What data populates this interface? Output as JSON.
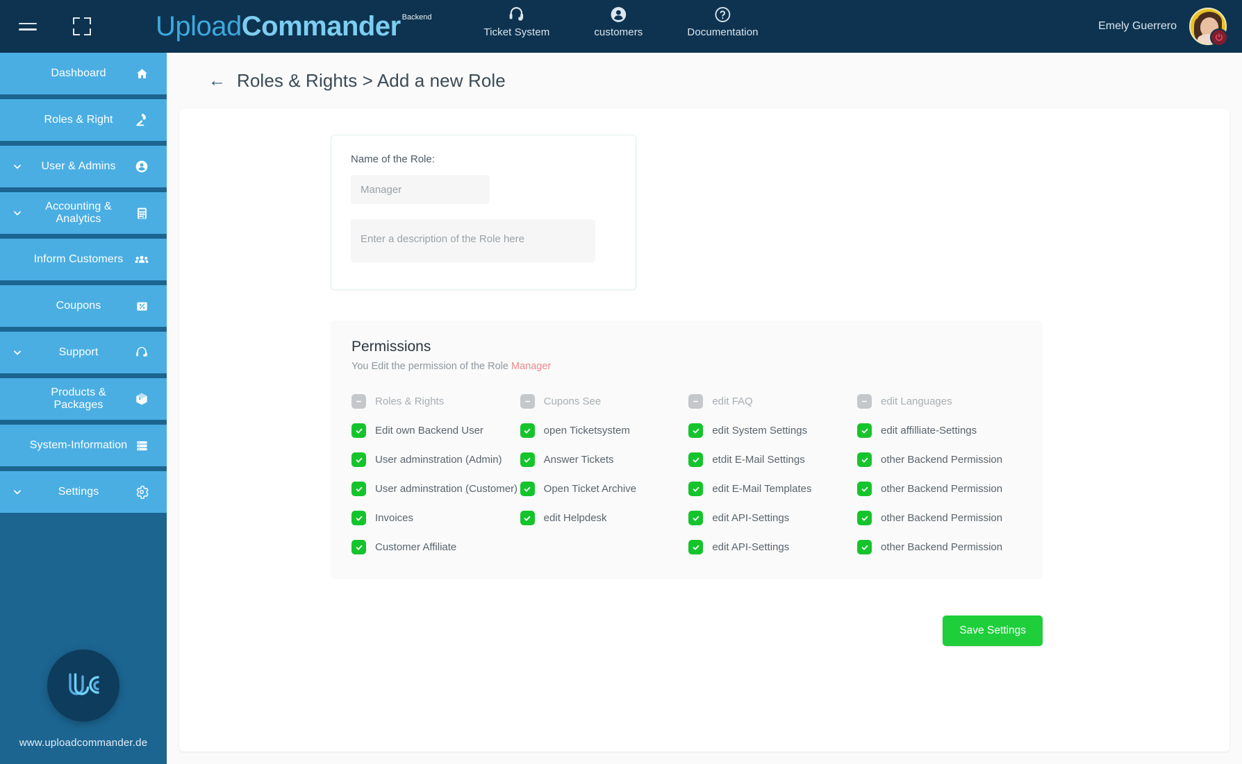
{
  "topbar": {
    "menu_icon": "hamburger-icon",
    "fullscreen_icon": "fullscreen-icon",
    "brand_part1": "Upload",
    "brand_part2": "Commander",
    "brand_superscript": "Backend",
    "nav": [
      {
        "label": "Ticket System",
        "icon": "headset-icon"
      },
      {
        "label": "customers",
        "icon": "person-circle-icon"
      },
      {
        "label": "Documentation",
        "icon": "question-circle-icon"
      }
    ],
    "user_name": "Emely Guerrero",
    "logout_icon": "power-icon"
  },
  "sidebar": {
    "items": [
      {
        "label": "Dashboard",
        "icon": "home-icon",
        "expandable": false
      },
      {
        "label": "Roles & Right",
        "icon": "gavel-icon",
        "expandable": false
      },
      {
        "label": "User & Admins",
        "icon": "person-circle-icon",
        "expandable": true
      },
      {
        "label": "Accounting & Analytics",
        "icon": "calculator-icon",
        "expandable": true
      },
      {
        "label": "Inform Customers",
        "icon": "people-icon",
        "expandable": false
      },
      {
        "label": "Coupons",
        "icon": "percent-tag-icon",
        "expandable": false
      },
      {
        "label": "Support",
        "icon": "headset-icon",
        "expandable": true
      },
      {
        "label": "Products & Packages",
        "icon": "box-icon",
        "expandable": false
      },
      {
        "label": "System-Information",
        "icon": "server-icon",
        "expandable": false
      },
      {
        "label": "Settings",
        "icon": "gear-icon",
        "expandable": true
      }
    ],
    "logo_alt": "uc-logo",
    "url": "www.uploadcommander.de"
  },
  "header": {
    "back_icon": "arrow-left-icon",
    "title": "Roles & Rights > Add a new Role"
  },
  "role_form": {
    "name_label": "Name of the Role:",
    "name_placeholder": "Manager",
    "name_value": "",
    "description_placeholder": "Enter a description of the Role here",
    "description_value": ""
  },
  "permissions": {
    "title": "Permissions",
    "subtitle_prefix": "You Edit the permission of the Role ",
    "subtitle_role": "Manager",
    "columns": [
      {
        "items": [
          {
            "label": "Roles & Rights",
            "checked": false
          },
          {
            "label": "Edit own Backend User",
            "checked": true
          },
          {
            "label": "User adminstration (Admin)",
            "checked": true
          },
          {
            "label": "User adminstration (Customer)",
            "checked": true
          },
          {
            "label": "Invoices",
            "checked": true
          },
          {
            "label": "Customer Affiliate",
            "checked": true
          }
        ]
      },
      {
        "items": [
          {
            "label": "Cupons See",
            "checked": false
          },
          {
            "label": "open Ticketsystem",
            "checked": true
          },
          {
            "label": "Answer Tickets",
            "checked": true
          },
          {
            "label": "Open Ticket Archive",
            "checked": true
          },
          {
            "label": "edit Helpdesk",
            "checked": true
          }
        ]
      },
      {
        "items": [
          {
            "label": "edit FAQ",
            "checked": false
          },
          {
            "label": "edit System Settings",
            "checked": true
          },
          {
            "label": "etdit E-Mail Settings",
            "checked": true
          },
          {
            "label": "edit E-Mail Templates",
            "checked": true
          },
          {
            "label": "edit API-Settings",
            "checked": true
          },
          {
            "label": "edit API-Settings",
            "checked": true
          }
        ]
      },
      {
        "items": [
          {
            "label": "edit Languages",
            "checked": false
          },
          {
            "label": "edit affilliate-Settings",
            "checked": true
          },
          {
            "label": "other Backend Permission",
            "checked": true
          },
          {
            "label": "other Backend Permission",
            "checked": true
          },
          {
            "label": "other Backend Permission",
            "checked": true
          },
          {
            "label": "other Backend Permission",
            "checked": true
          }
        ]
      }
    ]
  },
  "actions": {
    "save_label": "Save Settings"
  },
  "colors": {
    "topbar_bg": "#0d3350",
    "sidebar_bg": "#1c6591",
    "sidebar_item": "#4aaee3",
    "checkbox_on": "#15c42c",
    "checkbox_off": "#c5c8cb",
    "save_button": "#1ece3a",
    "role_highlight": "#e98b8b"
  }
}
